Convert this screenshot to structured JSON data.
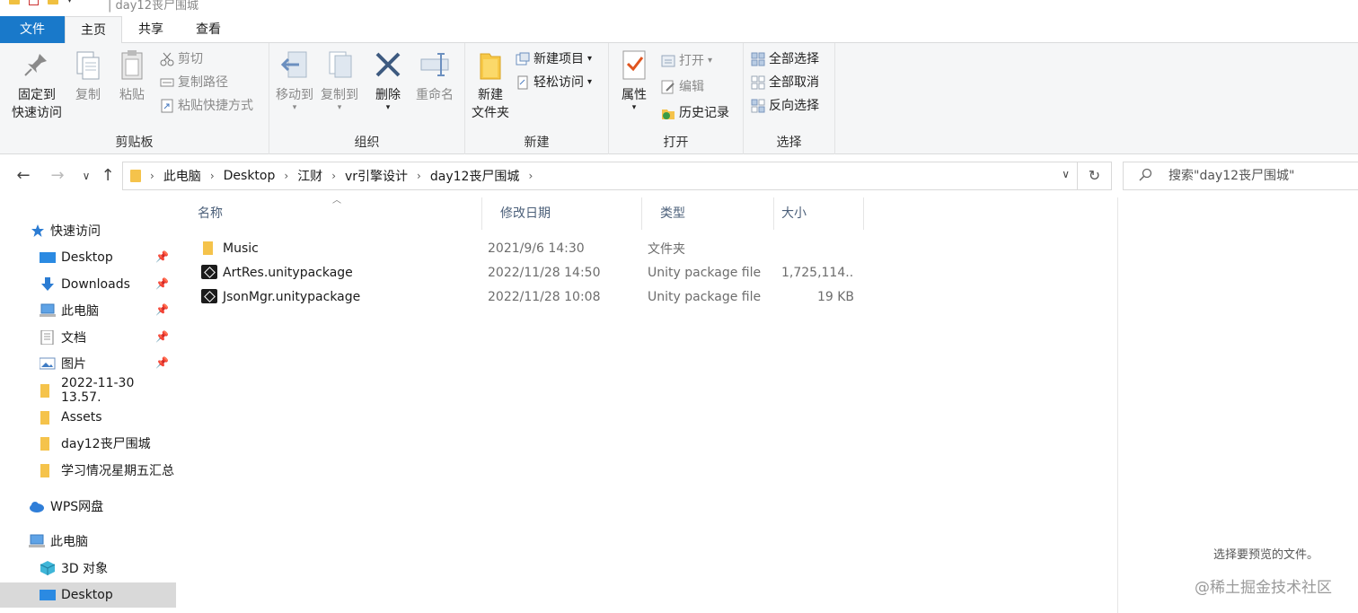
{
  "window": {
    "title": "day12丧尸围城"
  },
  "tabs": {
    "file": "文件",
    "home": "主页",
    "share": "共享",
    "view": "查看"
  },
  "ribbon": {
    "clipboard": {
      "label": "剪贴板",
      "pin_line1": "固定到",
      "pin_line2": "快速访问",
      "copy": "复制",
      "paste": "粘贴",
      "cut": "剪切",
      "copy_path": "复制路径",
      "paste_shortcut": "粘贴快捷方式"
    },
    "organize": {
      "label": "组织",
      "move_to": "移动到",
      "copy_to": "复制到",
      "delete": "删除",
      "rename": "重命名"
    },
    "new": {
      "label": "新建",
      "new_folder_line1": "新建",
      "new_folder_line2": "文件夹",
      "new_item": "新建项目",
      "easy_access": "轻松访问"
    },
    "open": {
      "label": "打开",
      "properties": "属性",
      "open": "打开",
      "edit": "编辑",
      "history": "历史记录"
    },
    "select": {
      "label": "选择",
      "select_all": "全部选择",
      "select_none": "全部取消",
      "invert": "反向选择"
    }
  },
  "address": {
    "crumbs": [
      "此电脑",
      "Desktop",
      "江财",
      "vr引擎设计",
      "day12丧尸围城"
    ],
    "search_placeholder": "搜索\"day12丧尸围城\""
  },
  "nav": {
    "quick_access": "快速访问",
    "items": [
      {
        "label": "Desktop",
        "icon": "desktop-icon",
        "pinned": true
      },
      {
        "label": "Downloads",
        "icon": "download-icon",
        "pinned": true
      },
      {
        "label": "此电脑",
        "icon": "computer-icon",
        "pinned": true
      },
      {
        "label": "文档",
        "icon": "document-icon",
        "pinned": true
      },
      {
        "label": "图片",
        "icon": "picture-icon",
        "pinned": true
      },
      {
        "label": "2022-11-30 13.57.",
        "icon": "folder-icon",
        "pinned": false
      },
      {
        "label": "Assets",
        "icon": "folder-icon",
        "pinned": false
      },
      {
        "label": "day12丧尸围城",
        "icon": "folder-icon",
        "pinned": false
      },
      {
        "label": "学习情况星期五汇总",
        "icon": "folder-icon",
        "pinned": false
      }
    ],
    "wps": "WPS网盘",
    "this_pc": "此电脑",
    "objects_3d": "3D 对象",
    "desktop": "Desktop"
  },
  "columns": {
    "name": "名称",
    "modified": "修改日期",
    "type": "类型",
    "size": "大小"
  },
  "files": [
    {
      "name": "Music",
      "date": "2021/9/6 14:30",
      "type": "文件夹",
      "size": "",
      "icon": "folder-icon"
    },
    {
      "name": "ArtRes.unitypackage",
      "date": "2022/11/28 14:50",
      "type": "Unity package file",
      "size": "1,725,114...",
      "icon": "unity-icon"
    },
    {
      "name": "JsonMgr.unitypackage",
      "date": "2022/11/28 10:08",
      "type": "Unity package file",
      "size": "19 KB",
      "icon": "unity-icon"
    }
  ],
  "preview": {
    "message": "选择要预览的文件。"
  },
  "watermark": "@稀土掘金技术社区",
  "colors": {
    "file_tab": "#1979ca",
    "ribbon_bg": "#f5f6f7",
    "nav_selected": "#d9d9d9"
  }
}
